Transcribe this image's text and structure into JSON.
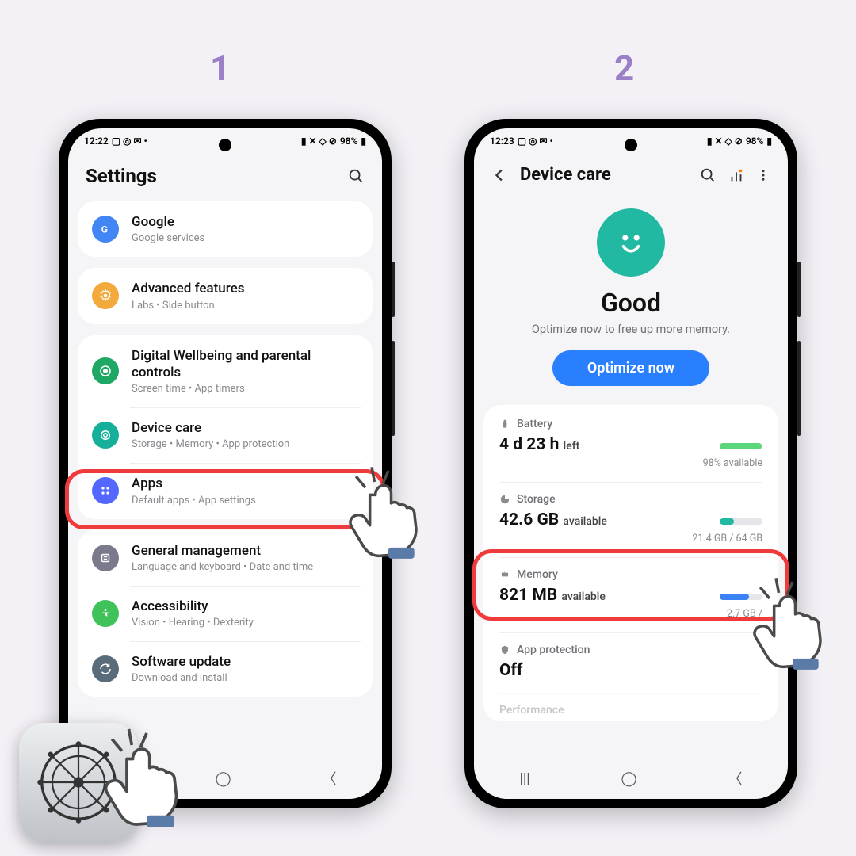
{
  "steps": {
    "one": "1",
    "two": "2"
  },
  "phone1": {
    "status": {
      "time": "12:22",
      "battery": "98%"
    },
    "title": "Settings",
    "items": {
      "google": {
        "title": "Google",
        "sub": "Google services"
      },
      "advanced": {
        "title": "Advanced features",
        "sub": "Labs  •  Side button"
      },
      "wellbeing": {
        "title": "Digital Wellbeing and parental controls",
        "sub": "Screen time  •  App timers"
      },
      "devicecare": {
        "title": "Device care",
        "sub": "Storage  •  Memory  •  App protection"
      },
      "apps": {
        "title": "Apps",
        "sub": "Default apps  •  App settings"
      },
      "general": {
        "title": "General management",
        "sub": "Language and keyboard  •  Date and time"
      },
      "accessibility": {
        "title": "Accessibility",
        "sub": "Vision  •  Hearing  •  Dexterity"
      },
      "update": {
        "title": "Software update",
        "sub": "Download and install"
      }
    }
  },
  "phone2": {
    "status": {
      "time": "12:23",
      "battery": "98%"
    },
    "title": "Device care",
    "hero": {
      "status": "Good",
      "sub": "Optimize now to free up more memory.",
      "button": "Optimize now"
    },
    "battery": {
      "label": "Battery",
      "value": "4 d 23 h",
      "unit": "left",
      "right": "98% available"
    },
    "storage": {
      "label": "Storage",
      "value": "42.6 GB",
      "unit": "available",
      "right": "21.4 GB / 64 GB"
    },
    "memory": {
      "label": "Memory",
      "value": "821 MB",
      "unit": "available",
      "right": "2.7 GB /"
    },
    "appprotection": {
      "label": "App protection",
      "value": "Off"
    },
    "performance": {
      "label": "Performance"
    }
  }
}
